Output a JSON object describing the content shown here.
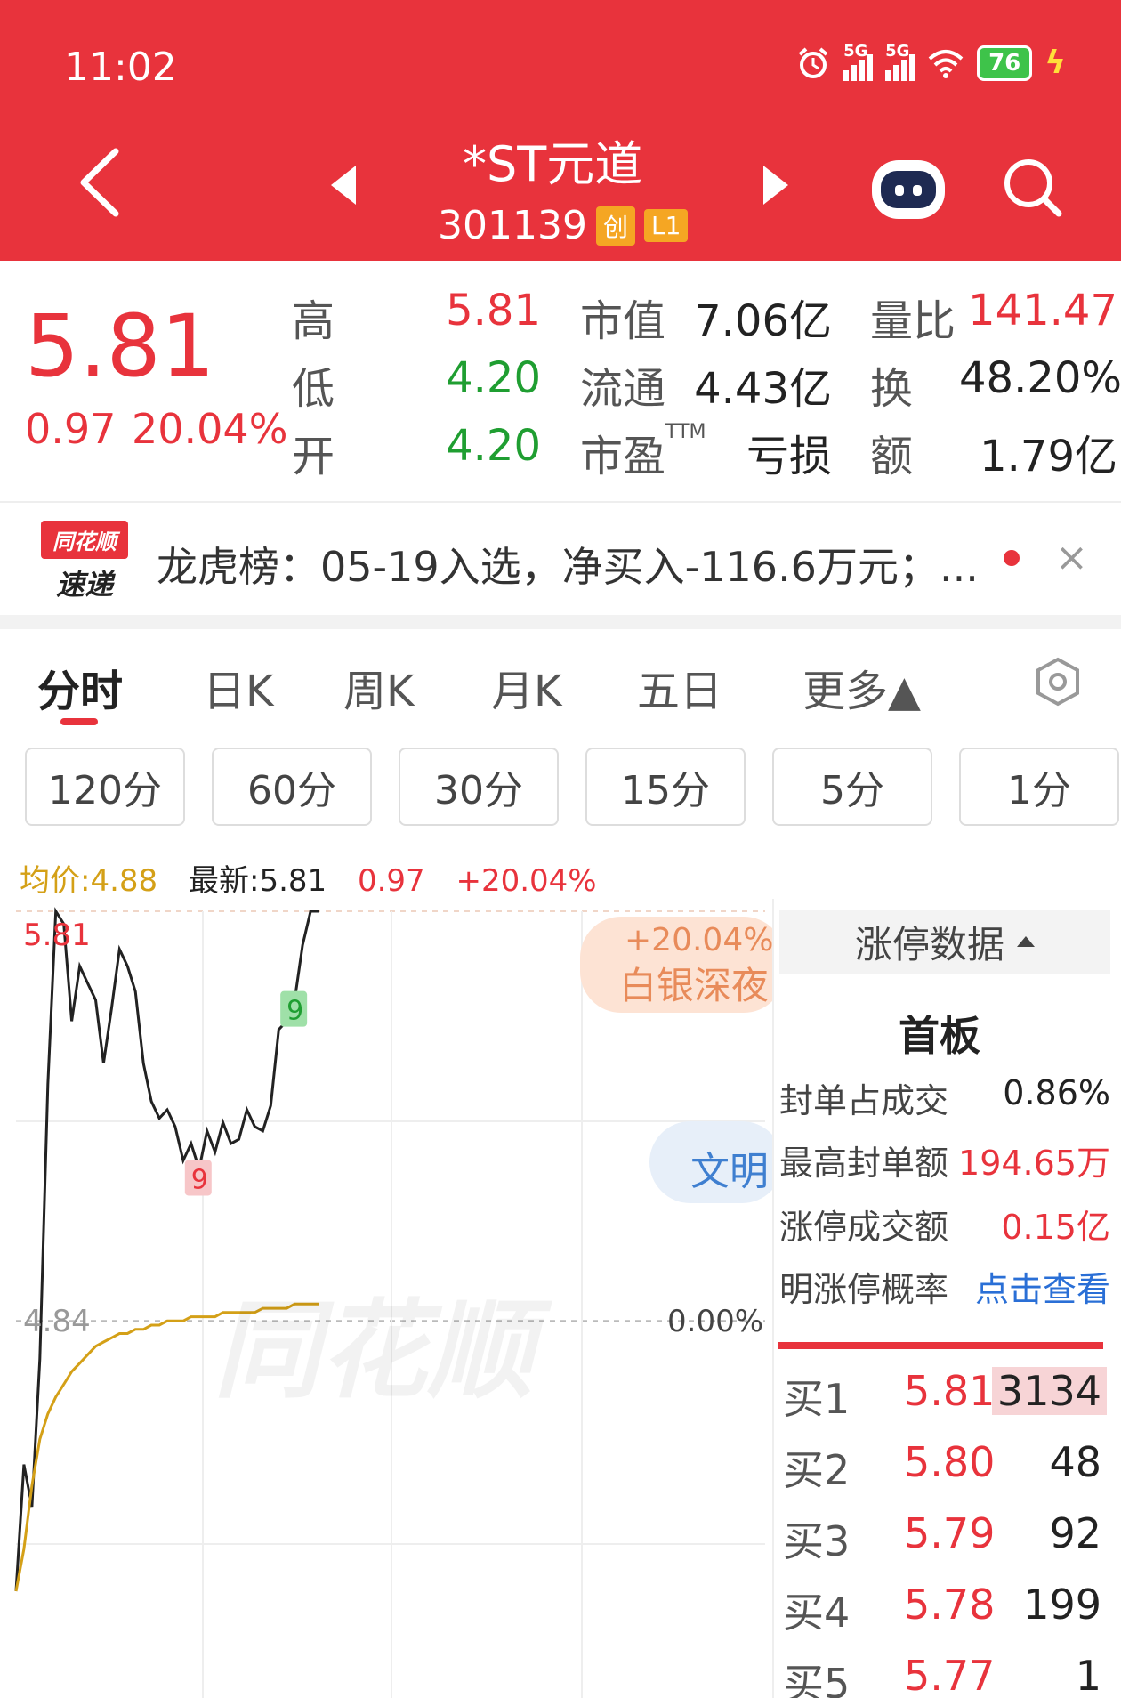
{
  "status_bar": {
    "time": "11:02",
    "network1": "5G",
    "network2": "5G",
    "battery": "76",
    "icons": [
      "alarm-icon",
      "signal-icon",
      "signal-icon",
      "wifi-icon",
      "battery-icon",
      "charging-icon"
    ]
  },
  "header": {
    "stock_name": "*ST元道",
    "stock_code": "301139",
    "tag_board": "创",
    "tag_level": "L1",
    "icons": [
      "back-icon",
      "prev-icon",
      "next-icon",
      "robot-icon",
      "search-icon"
    ]
  },
  "quote": {
    "price": "5.81",
    "change": "0.97",
    "change_pct": "20.04%",
    "high_label": "高",
    "high": "5.81",
    "low_label": "低",
    "low": "4.20",
    "open_label": "开",
    "open": "4.20",
    "mcap_label": "市值",
    "mcap": "7.06亿",
    "float_label": "流通",
    "float": "4.43亿",
    "pe_label": "市盈",
    "pe_suffix": "TTM",
    "pe": "亏损",
    "vol_ratio_label": "量比",
    "vol_ratio": "141.47",
    "turnover_label": "换",
    "turnover": "48.20%",
    "amount_label": "额",
    "amount": "1.79亿"
  },
  "notice": {
    "logo_top": "同花顺",
    "logo_bottom": "速递",
    "text": "龙虎榜：05-19入选，净买入-116.6万元；...",
    "close": "×"
  },
  "tabs": {
    "items": [
      "分时",
      "日K",
      "周K",
      "月K",
      "五日",
      "更多▲"
    ],
    "active": 0
  },
  "subtabs": [
    "120分",
    "60分",
    "30分",
    "15分",
    "5分",
    "1分"
  ],
  "chart": {
    "avg_label": "均价:4.88",
    "latest_label": "最新:5.81",
    "change": "0.97",
    "change_pct": "+20.04%",
    "top_price": "5.81",
    "ref_price": "4.84",
    "ref_pct": "0.00%",
    "marker_low": "9",
    "marker_high": "9",
    "watermark": "同花顺",
    "bubble1_line1": "+20.04%",
    "bubble1_line2": "白银深夜",
    "bubble2": "文明",
    "colors": {
      "price_line": "#222222",
      "avg_line": "#d4a017",
      "up": "#e8333c",
      "down": "#1f9e31"
    }
  },
  "chart_data": {
    "type": "line",
    "title": "",
    "xlabel": "",
    "ylabel": "",
    "ylim": [
      4.2,
      5.81
    ],
    "ref_line": 4.84,
    "series": [
      {
        "name": "",
        "values": [
          4.2,
          4.5,
          4.4,
          4.75,
          5.4,
          5.81,
          5.78,
          5.55,
          5.68,
          5.64,
          5.6,
          5.45,
          5.58,
          5.72,
          5.68,
          5.62,
          5.45,
          5.36,
          5.32,
          5.34,
          5.3,
          5.22,
          5.26,
          5.2,
          5.29,
          5.24,
          5.31,
          5.26,
          5.27,
          5.34,
          5.3,
          5.29,
          5.35,
          5.53,
          5.55,
          5.6,
          5.73,
          5.81,
          5.81
        ]
      },
      {
        "name": "",
        "values": [
          4.2,
          4.3,
          4.45,
          4.56,
          4.62,
          4.66,
          4.69,
          4.72,
          4.74,
          4.76,
          4.78,
          4.79,
          4.8,
          4.81,
          4.81,
          4.82,
          4.82,
          4.83,
          4.83,
          4.84,
          4.84,
          4.84,
          4.85,
          4.85,
          4.85,
          4.85,
          4.86,
          4.86,
          4.86,
          4.86,
          4.86,
          4.87,
          4.87,
          4.87,
          4.87,
          4.88,
          4.88,
          4.88,
          4.88
        ]
      }
    ]
  },
  "side_panel": {
    "header": "涨停数据",
    "title": "首板",
    "rows": [
      {
        "label": "封单占成交",
        "value": "0.86%"
      },
      {
        "label": "最高封单额",
        "value": "194.65万"
      },
      {
        "label": "涨停成交额",
        "value": "0.15亿"
      },
      {
        "label": "明涨停概率",
        "value": "点击查看"
      }
    ],
    "bids": [
      {
        "label": "买1",
        "price": "5.81",
        "qty": "3134"
      },
      {
        "label": "买2",
        "price": "5.80",
        "qty": "48"
      },
      {
        "label": "买3",
        "price": "5.79",
        "qty": "92"
      },
      {
        "label": "买4",
        "price": "5.78",
        "qty": "199"
      },
      {
        "label": "买5",
        "price": "5.77",
        "qty": "1"
      }
    ]
  }
}
